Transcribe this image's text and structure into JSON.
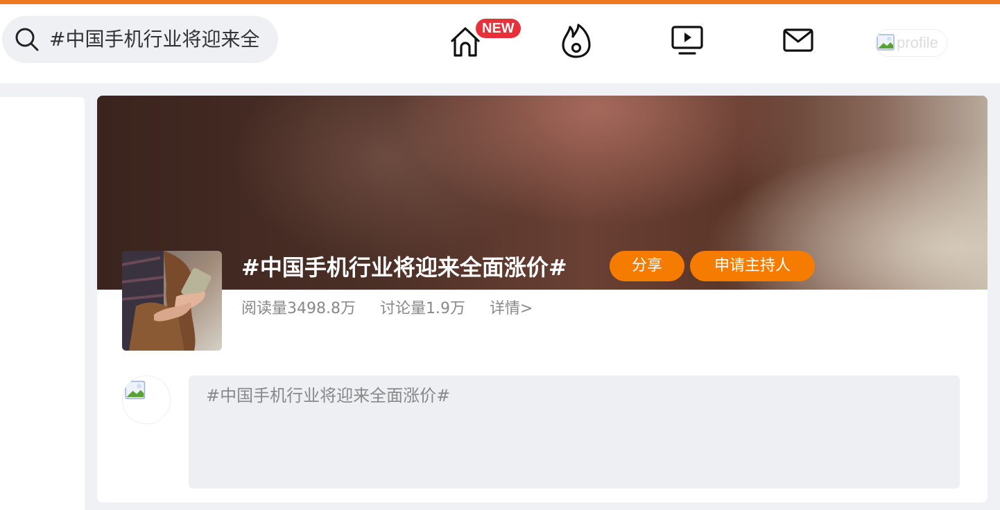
{
  "header": {
    "search": {
      "query": "#中国手机行业将迎来全"
    },
    "nav": [
      {
        "icon": "home-icon",
        "badge": "NEW"
      },
      {
        "icon": "hot-flame-icon"
      },
      {
        "icon": "video-icon"
      },
      {
        "icon": "mail-icon"
      }
    ],
    "profile_alt": "profile"
  },
  "topic": {
    "title": "#中国手机行业将迎来全面涨价#",
    "share_label": "分享",
    "host_label": "申请主持人",
    "reads": "阅读量3498.8万",
    "discussions": "讨论量1.9万",
    "details": "详情>"
  },
  "compose": {
    "placeholder": "#中国手机行业将迎来全面涨价#"
  },
  "colors": {
    "accent": "#f57c00",
    "topline": "#f0791e",
    "badge": "#e8303a"
  }
}
